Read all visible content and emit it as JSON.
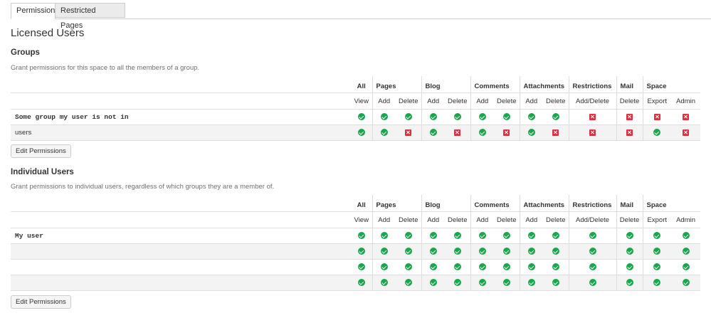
{
  "tabs": [
    {
      "label": "Permissions",
      "active": true
    },
    {
      "label": "Restricted Pages",
      "active": false
    }
  ],
  "page_title": "Licensed Users",
  "columns": {
    "groups": [
      "All",
      "Pages",
      "Blog",
      "Comments",
      "Attachments",
      "Restrictions",
      "Mail",
      "Space"
    ],
    "sub": [
      "View",
      "Add",
      "Delete",
      "Add",
      "Delete",
      "Add",
      "Delete",
      "Add",
      "Delete",
      "Add/Delete",
      "Delete",
      "Export",
      "Admin"
    ]
  },
  "groups_section": {
    "heading": "Groups",
    "description": "Grant permissions for this space to all the members of a group.",
    "rows": [
      {
        "name": "Some group my user is not in",
        "perms": [
          true,
          true,
          true,
          true,
          true,
          true,
          true,
          true,
          true,
          false,
          false,
          false,
          false
        ]
      },
      {
        "name": "users",
        "perms": [
          true,
          true,
          false,
          true,
          false,
          true,
          false,
          true,
          false,
          false,
          false,
          true,
          false
        ]
      }
    ],
    "edit_button": "Edit Permissions"
  },
  "users_section": {
    "heading": "Individual Users",
    "description": "Grant permissions to individual users, regardless of which groups they are a member of.",
    "rows": [
      {
        "name": "My user",
        "perms": [
          true,
          true,
          true,
          true,
          true,
          true,
          true,
          true,
          true,
          true,
          true,
          true,
          true
        ]
      },
      {
        "name": "",
        "perms": [
          true,
          true,
          true,
          true,
          true,
          true,
          true,
          true,
          true,
          true,
          true,
          true,
          true
        ]
      },
      {
        "name": "",
        "perms": [
          true,
          true,
          true,
          true,
          true,
          true,
          true,
          true,
          true,
          true,
          true,
          true,
          true
        ]
      },
      {
        "name": "",
        "perms": [
          true,
          true,
          true,
          true,
          true,
          true,
          true,
          true,
          true,
          true,
          true,
          true,
          true
        ]
      }
    ],
    "edit_button": "Edit Permissions"
  },
  "colors": {
    "granted": "#18a84c",
    "denied": "#d8323f"
  },
  "icons": {
    "granted": "check-circle-icon",
    "denied": "x-square-icon"
  }
}
